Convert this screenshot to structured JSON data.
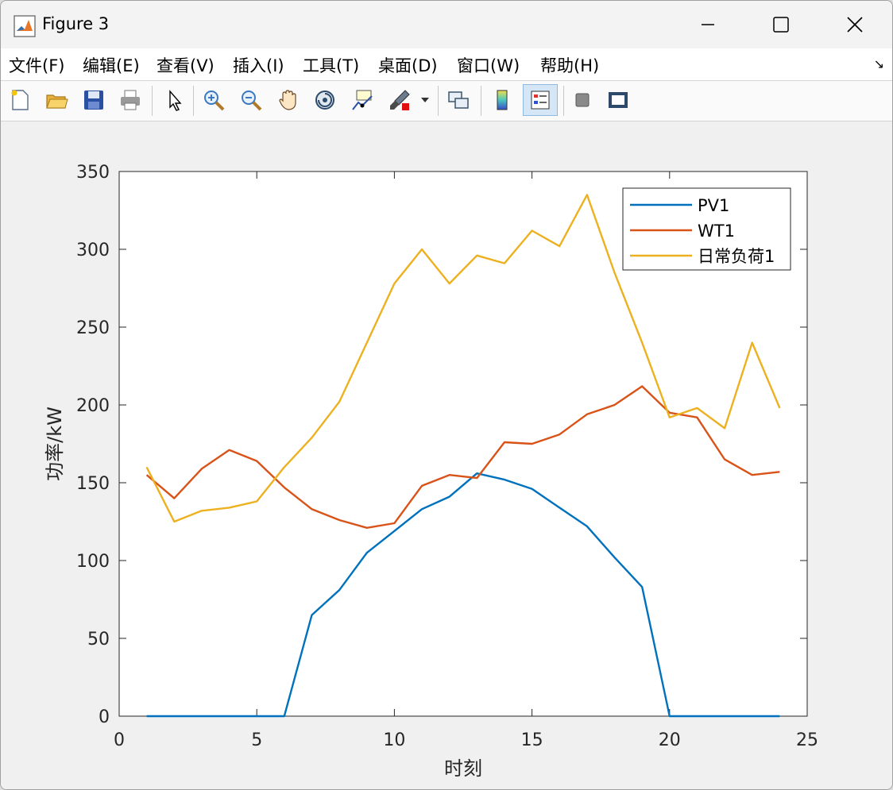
{
  "window": {
    "title": "Figure 3",
    "accent": "#0072bd"
  },
  "menu": {
    "items": [
      "文件(F)",
      "编辑(E)",
      "查看(V)",
      "插入(I)",
      "工具(T)",
      "桌面(D)",
      "窗口(W)",
      "帮助(H)"
    ]
  },
  "toolbar": {
    "icons": [
      "new-figure-icon",
      "open-file-icon",
      "save-icon",
      "print-icon",
      "pointer-icon",
      "zoom-in-icon",
      "zoom-out-icon",
      "pan-hand-icon",
      "rotate-3d-icon",
      "data-cursor-icon",
      "brush-icon",
      "link-plot-icon",
      "colorbar-icon",
      "legend-icon",
      "hide-plot-tools-icon",
      "show-plot-tools-icon"
    ]
  },
  "chart_data": {
    "type": "line",
    "title": "",
    "xlabel": "时刻",
    "ylabel": "功率/kW",
    "xlim": [
      0,
      25
    ],
    "ylim": [
      0,
      350
    ],
    "xticks": [
      0,
      5,
      10,
      15,
      20,
      25
    ],
    "yticks": [
      0,
      50,
      100,
      150,
      200,
      250,
      300,
      350
    ],
    "grid": false,
    "legend_position": "top-right",
    "x": [
      1,
      2,
      3,
      4,
      5,
      6,
      7,
      8,
      9,
      10,
      11,
      12,
      13,
      14,
      15,
      16,
      17,
      18,
      19,
      20,
      21,
      22,
      23,
      24
    ],
    "series": [
      {
        "name": "PV1",
        "color": "#0072bd",
        "values": [
          0,
          0,
          0,
          0,
          0,
          0,
          65,
          81,
          105,
          119,
          133,
          141,
          156,
          152,
          146,
          134,
          122,
          102,
          83,
          0,
          0,
          0,
          0,
          0
        ]
      },
      {
        "name": "WT1",
        "color": "#d95319",
        "values": [
          155,
          140,
          159,
          171,
          164,
          147,
          133,
          126,
          121,
          124,
          148,
          155,
          153,
          176,
          175,
          181,
          194,
          200,
          212,
          195,
          192,
          165,
          155,
          157
        ]
      },
      {
        "name": "日常负荷1",
        "color": "#edb120",
        "values": [
          160,
          125,
          132,
          134,
          138,
          160,
          179,
          202,
          240,
          278,
          300,
          278,
          296,
          291,
          312,
          302,
          335,
          285,
          240,
          192,
          198,
          185,
          240,
          198
        ]
      }
    ]
  }
}
